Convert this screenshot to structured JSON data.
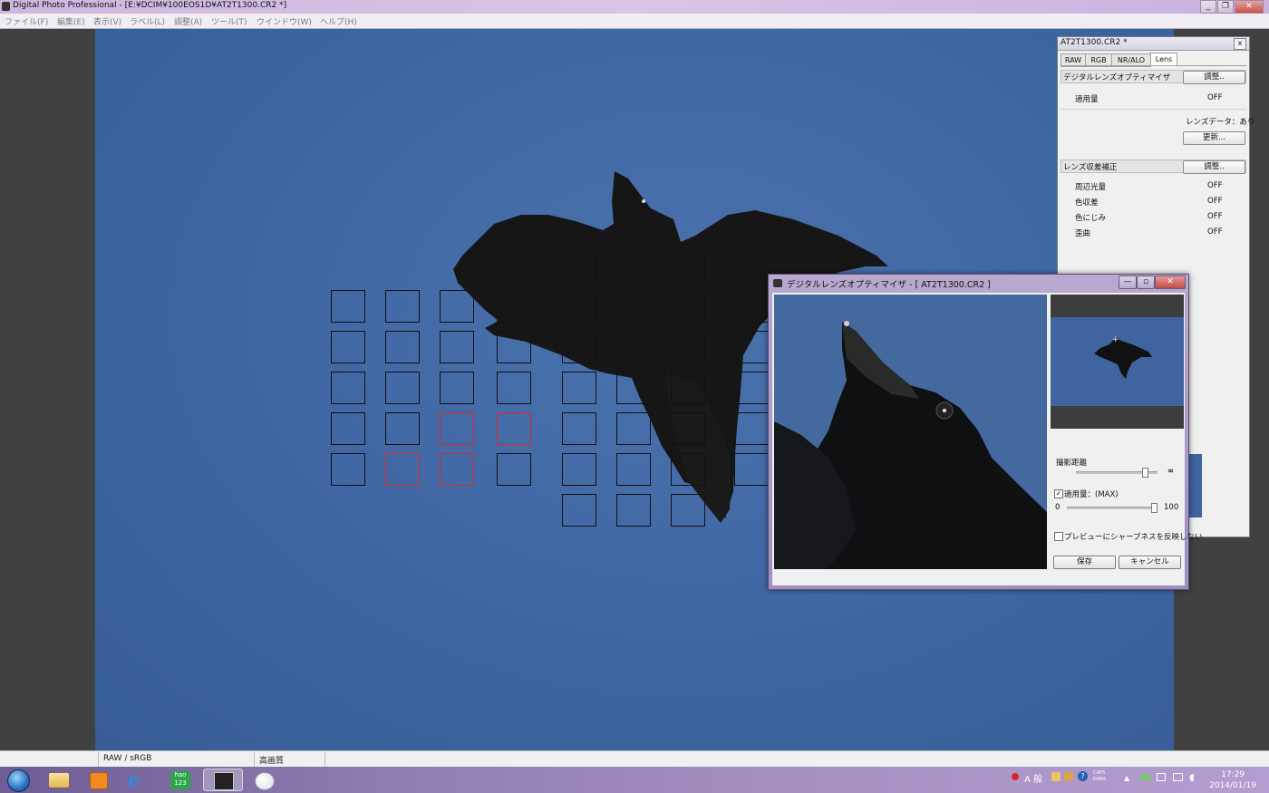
{
  "window": {
    "title": "Digital Photo Professional - [E:¥DCIM¥100EOS1D¥AT2T1300.CR2 *]",
    "controls": {
      "minimize": "_",
      "maximize": "❐",
      "close": "✕"
    }
  },
  "menu": [
    {
      "label": "ファイル(F)"
    },
    {
      "label": "編集(E)"
    },
    {
      "label": "表示(V)"
    },
    {
      "label": "ラベル(L)"
    },
    {
      "label": "調整(A)"
    },
    {
      "label": "ツール(T)"
    },
    {
      "label": "ウインドウ(W)"
    },
    {
      "label": "ヘルプ(H)"
    }
  ],
  "status_bar": {
    "color_mode": "RAW / sRGB",
    "quality": "高画質"
  },
  "palette": {
    "title": "AT2T1300.CR2 *",
    "close": "x",
    "tabs": [
      {
        "label": "RAW",
        "selected": false
      },
      {
        "label": "RGB",
        "selected": false
      },
      {
        "label": "NR/ALO",
        "selected": false
      },
      {
        "label": "Lens",
        "selected": true
      }
    ],
    "dlo_section": {
      "title": "デジタルレンズオプティマイザ",
      "adjust_button": "調整..",
      "amount_label": "適用量",
      "amount_value": "OFF",
      "lens_data": "レンズデータ：あり",
      "update_button": "更新..."
    },
    "aberration_section": {
      "title": "レンズ収差補正",
      "adjust_button": "調整..",
      "items": [
        {
          "label": "周辺光量",
          "value": "OFF"
        },
        {
          "label": "色収差",
          "value": "OFF"
        },
        {
          "label": "色にじみ",
          "value": "OFF"
        },
        {
          "label": "歪曲",
          "value": "OFF"
        }
      ]
    }
  },
  "dlo_dialog": {
    "title": "デジタルレンズオプティマイザ - [ AT2T1300.CR2 ]",
    "controls": {
      "minimize": "—",
      "maximize": "▫",
      "close": "✕"
    },
    "distance_label": "撮影距離",
    "distance_infinity": "∞",
    "amount_checkbox_label": "適用量：(MAX)",
    "amount_checked": true,
    "amount_min": "0",
    "amount_max": "100",
    "sharpness_checkbox_label": "プレビューにシャープネスを反映しない",
    "sharpness_checked": false,
    "save_button": "保存",
    "cancel_button": "キャンセル"
  },
  "taskbar": {
    "apps": [
      {
        "icon": "start-orb-icon"
      },
      {
        "icon": "explorer-folder-icon"
      },
      {
        "icon": "media-player-icon"
      },
      {
        "icon": "internet-explorer-icon"
      },
      {
        "icon": "hao123-icon",
        "label": "hao 123"
      },
      {
        "icon": "dpp-app-icon",
        "active": true
      },
      {
        "icon": "paint-icon"
      }
    ],
    "tray": {
      "ime_label": "A 般",
      "caps": "CAPS",
      "kana": "KANA",
      "time": "17:29",
      "date": "2014/01/19"
    }
  },
  "colors": {
    "sky": "#4169a6",
    "af_active": "#d62b2b",
    "af_inactive": "#111111",
    "taskbar": "#8e7db0"
  }
}
